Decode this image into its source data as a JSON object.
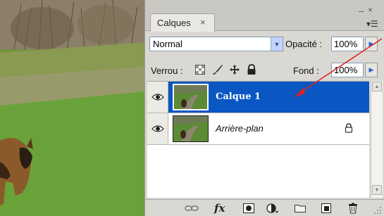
{
  "panel": {
    "tab_label": "Calques",
    "tab_close": "×",
    "minimize": "–",
    "close": "×",
    "menu_glyph": "▾☰"
  },
  "blend": {
    "mode": "Normal",
    "opacity_label": "Opacité :",
    "opacity_value": "100%"
  },
  "lock": {
    "label": "Verrou :",
    "icons": [
      "transparency-lock-icon",
      "brush-lock-icon",
      "move-lock-icon",
      "padlock-icon"
    ],
    "fill_label": "Fond :",
    "fill_value": "100%"
  },
  "layers": [
    {
      "name": "Calque 1",
      "selected": true,
      "visible": true,
      "locked": false
    },
    {
      "name": "Arrière-plan",
      "selected": false,
      "visible": true,
      "locked": true
    }
  ],
  "bottom_toolbar": {
    "fx_label": "fx",
    "icons": [
      "link-layers-icon",
      "layer-style-icon",
      "layer-mask-icon",
      "adjustment-layer-icon",
      "new-group-icon",
      "new-layer-icon",
      "trash-icon"
    ]
  },
  "colors": {
    "selection": "#0a56c3",
    "annotation_arrow": "#e02020"
  }
}
